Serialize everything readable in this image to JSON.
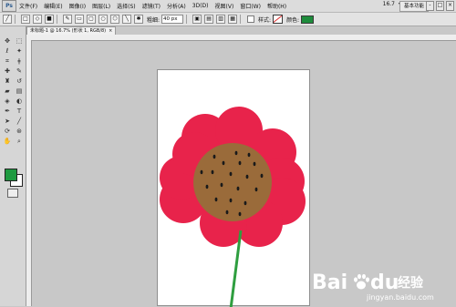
{
  "app": {
    "logo": "Ps"
  },
  "menu": {
    "items": [
      "文件(F)",
      "编辑(E)",
      "图像(I)",
      "图层(L)",
      "选择(S)",
      "滤镜(T)",
      "分析(A)",
      "3D(D)",
      "视图(V)",
      "窗口(W)",
      "帮助(H)"
    ],
    "zoom": "16.7",
    "workspace": "基本功能",
    "win": [
      "-",
      "□",
      "×"
    ]
  },
  "options": {
    "weight_label": "粗细:",
    "weight_value": "40 px",
    "style_label": "样式:",
    "color_label": "颜色:",
    "color": "#1e8c3c"
  },
  "document": {
    "tab": "未标题-1 @ 16.7% (形状 1, RGB/8)",
    "close": "×"
  },
  "colors": {
    "petal": "#e8234b",
    "center": "#9a6b3a",
    "seeds": "#1a1a1a",
    "stem": "#2e9e3f",
    "foreground": "#1e9a40",
    "background": "#ffffff"
  },
  "watermark": {
    "brand_a": "Bai",
    "brand_b": "du",
    "product": "经验",
    "url": "jingyan.baidu.com"
  }
}
